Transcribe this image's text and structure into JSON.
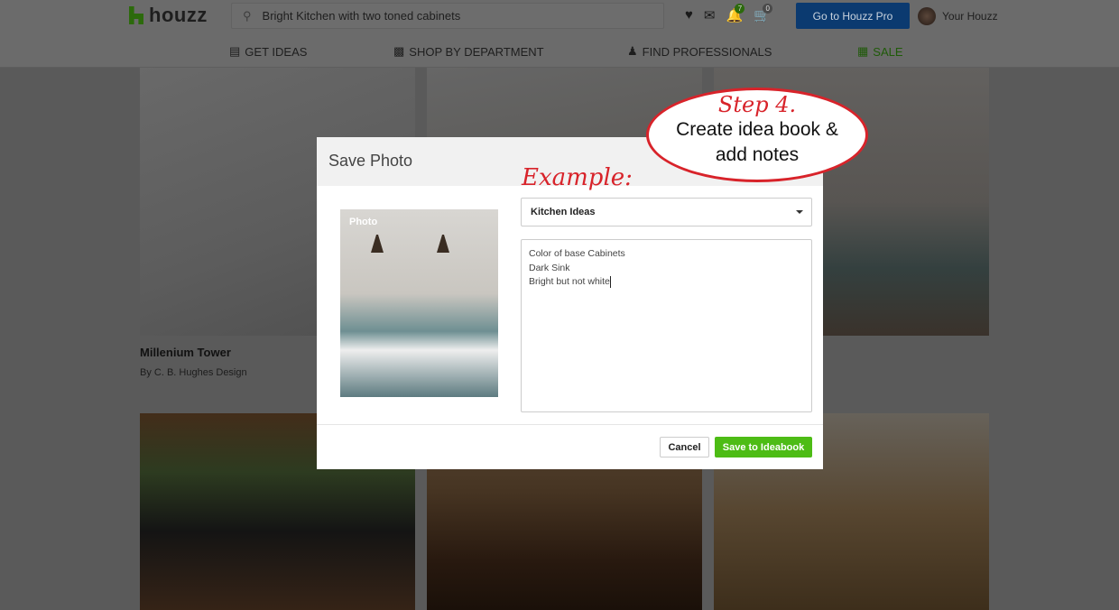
{
  "header": {
    "logo": "houzz",
    "search_value": "Bright Kitchen with two toned cabinets",
    "notifications_count": "7",
    "cart_count": "0",
    "pro_button": "Go to Houzz Pro",
    "account": "Your Houzz"
  },
  "nav": {
    "items": [
      {
        "label": "GET IDEAS",
        "icon": "ideabook-icon"
      },
      {
        "label": "SHOP BY DEPARTMENT",
        "icon": "chair-icon"
      },
      {
        "label": "FIND PROFESSIONALS",
        "icon": "person-icon"
      },
      {
        "label": "SALE",
        "icon": "gift-icon"
      }
    ]
  },
  "gallery": {
    "first": {
      "title": "Millenium Tower",
      "byline": "By C. B. Hughes Design"
    }
  },
  "modal": {
    "title": "Save Photo",
    "photo_label": "Photo",
    "ideabook_selected": "Kitchen Ideas",
    "notes": [
      "Color of base Cabinets",
      "Dark Sink",
      "Bright but not white"
    ],
    "cancel": "Cancel",
    "save": "Save to Ideabook"
  },
  "annotations": {
    "example": "Example:",
    "step": "Step 4.",
    "callout_line1": "Create idea book &",
    "callout_line2": "add notes"
  },
  "colors": {
    "brand_green": "#4dbc15",
    "pro_blue": "#0a5ab0",
    "annotation_red": "#d8232a"
  }
}
